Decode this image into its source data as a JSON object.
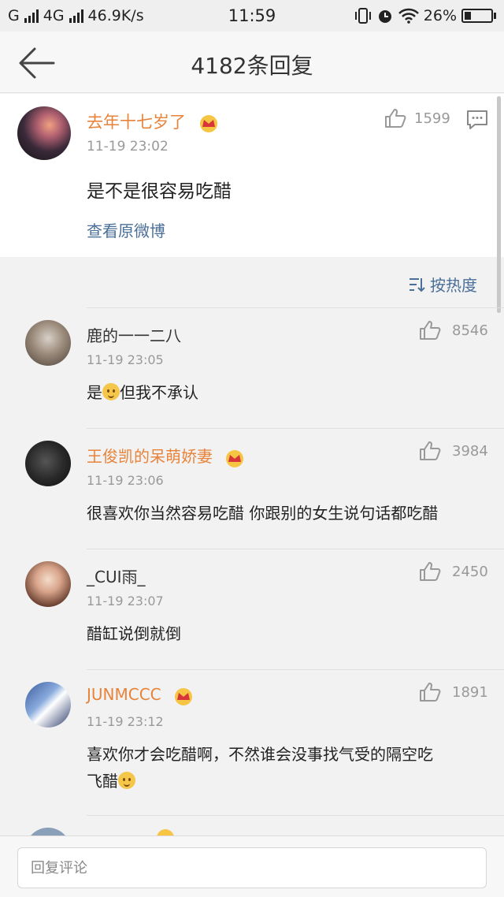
{
  "status_bar": {
    "carrier1": "G",
    "network": "4G",
    "speed": "46.9K/s",
    "time": "11:59",
    "battery": "26%"
  },
  "header": {
    "title": "4182条回复"
  },
  "main_post": {
    "user": "去年十七岁了",
    "time": "11-19 23:02",
    "likes": "1599",
    "text": "是不是很容易吃醋",
    "view_original": "查看原微博"
  },
  "sort": {
    "label": "按热度"
  },
  "replies": [
    {
      "user": "鹿的一一二八",
      "vip": false,
      "time": "11-19 23:05",
      "likes": "8546",
      "text_before": "是",
      "text_after": "但我不承认"
    },
    {
      "user": "王俊凯的呆萌娇妻",
      "vip": true,
      "time": "11-19 23:06",
      "likes": "3984",
      "text": "很喜欢你当然容易吃醋 你跟别的女生说句话都吃醋"
    },
    {
      "user": "_CUI雨_",
      "vip": false,
      "time": "11-19 23:07",
      "likes": "2450",
      "text": "醋缸说倒就倒"
    },
    {
      "user": "JUNMCCC",
      "vip": true,
      "time": "11-19 23:12",
      "likes": "1891",
      "text_line1": "喜欢你才会吃醋啊，不然谁会没事找气受的隔空吃",
      "text_line2": "飞醋"
    }
  ],
  "footer": {
    "reply_placeholder": "回复评论"
  },
  "colors": {
    "vip_name": "#e8833a",
    "link": "#4a6f98",
    "muted": "#999999"
  }
}
